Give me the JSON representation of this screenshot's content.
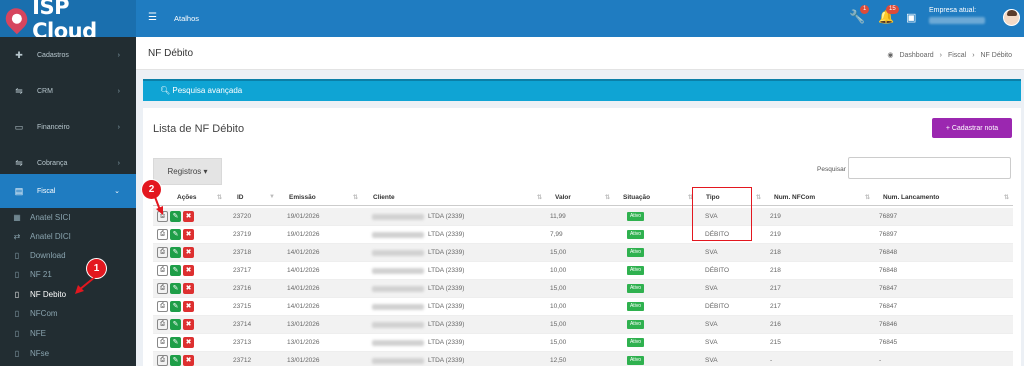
{
  "brand": {
    "name": "ISP Cloud"
  },
  "topbar": {
    "shortcut_label": "Atalhos",
    "tools_badge": "1",
    "notif_badge": "15",
    "company_label": "Empresa atual:"
  },
  "sidebar": {
    "items": [
      {
        "label": "Cadastros",
        "icon": "plus-icon"
      },
      {
        "label": "CRM",
        "icon": "handshake-icon"
      },
      {
        "label": "Financeiro",
        "icon": "money-icon"
      },
      {
        "label": "Cobrança",
        "icon": "handshake-icon"
      },
      {
        "label": "Fiscal",
        "icon": "file-icon"
      }
    ],
    "fiscal_sub": [
      {
        "label": "Anatel SICI",
        "icon": "table-icon"
      },
      {
        "label": "Anatel DICI",
        "icon": "swap-icon"
      },
      {
        "label": "Download",
        "icon": "file-icon"
      },
      {
        "label": "NF 21",
        "icon": "file-icon"
      },
      {
        "label": "NF Debito",
        "icon": "file-icon"
      },
      {
        "label": "NFCom",
        "icon": "file-icon"
      },
      {
        "label": "NFE",
        "icon": "file-icon"
      },
      {
        "label": "NFse",
        "icon": "file-icon"
      }
    ]
  },
  "header": {
    "title": "NF Débito",
    "breadcrumb": [
      "Dashboard",
      "Fiscal",
      "NF Débito"
    ]
  },
  "search_bar": {
    "label": "Pesquisa avançada"
  },
  "panel": {
    "title": "Lista de NF Débito",
    "add_button": "+ Cadastrar nota",
    "records_button": "Registros ▾",
    "search_label": "Pesquisar"
  },
  "table": {
    "columns": [
      "Ações",
      "ID",
      "Emissão",
      "Cliente",
      "Valor",
      "Situação",
      "Tipo",
      "Num. NFCom",
      "Num. Lancamento"
    ],
    "status_label": "Ativo",
    "rows": [
      {
        "id": "23720",
        "emissao": "19/01/2026",
        "cliente": "LTDA (2339)",
        "valor": "11,99",
        "tipo": "SVA",
        "nfcom": "219",
        "lanc": "76897"
      },
      {
        "id": "23719",
        "emissao": "19/01/2026",
        "cliente": "LTDA (2339)",
        "valor": "7,99",
        "tipo": "DÉBITO",
        "nfcom": "219",
        "lanc": "76897"
      },
      {
        "id": "23718",
        "emissao": "14/01/2026",
        "cliente": "LTDA (2339)",
        "valor": "15,00",
        "tipo": "SVA",
        "nfcom": "218",
        "lanc": "76848"
      },
      {
        "id": "23717",
        "emissao": "14/01/2026",
        "cliente": "LTDA (2339)",
        "valor": "10,00",
        "tipo": "DÉBITO",
        "nfcom": "218",
        "lanc": "76848"
      },
      {
        "id": "23716",
        "emissao": "14/01/2026",
        "cliente": "LTDA (2339)",
        "valor": "15,00",
        "tipo": "SVA",
        "nfcom": "217",
        "lanc": "76847"
      },
      {
        "id": "23715",
        "emissao": "14/01/2026",
        "cliente": "LTDA (2339)",
        "valor": "10,00",
        "tipo": "DÉBITO",
        "nfcom": "217",
        "lanc": "76847"
      },
      {
        "id": "23714",
        "emissao": "13/01/2026",
        "cliente": "LTDA (2339)",
        "valor": "15,00",
        "tipo": "SVA",
        "nfcom": "216",
        "lanc": "76846"
      },
      {
        "id": "23713",
        "emissao": "13/01/2026",
        "cliente": "LTDA (2339)",
        "valor": "15,00",
        "tipo": "SVA",
        "nfcom": "215",
        "lanc": "76845"
      },
      {
        "id": "23712",
        "emissao": "13/01/2026",
        "cliente": "LTDA (2339)",
        "valor": "12,50",
        "tipo": "SVA",
        "nfcom": "-",
        "lanc": "-"
      }
    ]
  },
  "annotations": {
    "callout_1": "1",
    "callout_2": "2"
  },
  "colors": {
    "primary": "#1f7cc1",
    "sidebar": "#222d32",
    "accent_purple": "#9b27b0",
    "search_bar": "#0fa4d4",
    "status_green": "#2fb14f",
    "annotation_red": "#e3171f"
  }
}
